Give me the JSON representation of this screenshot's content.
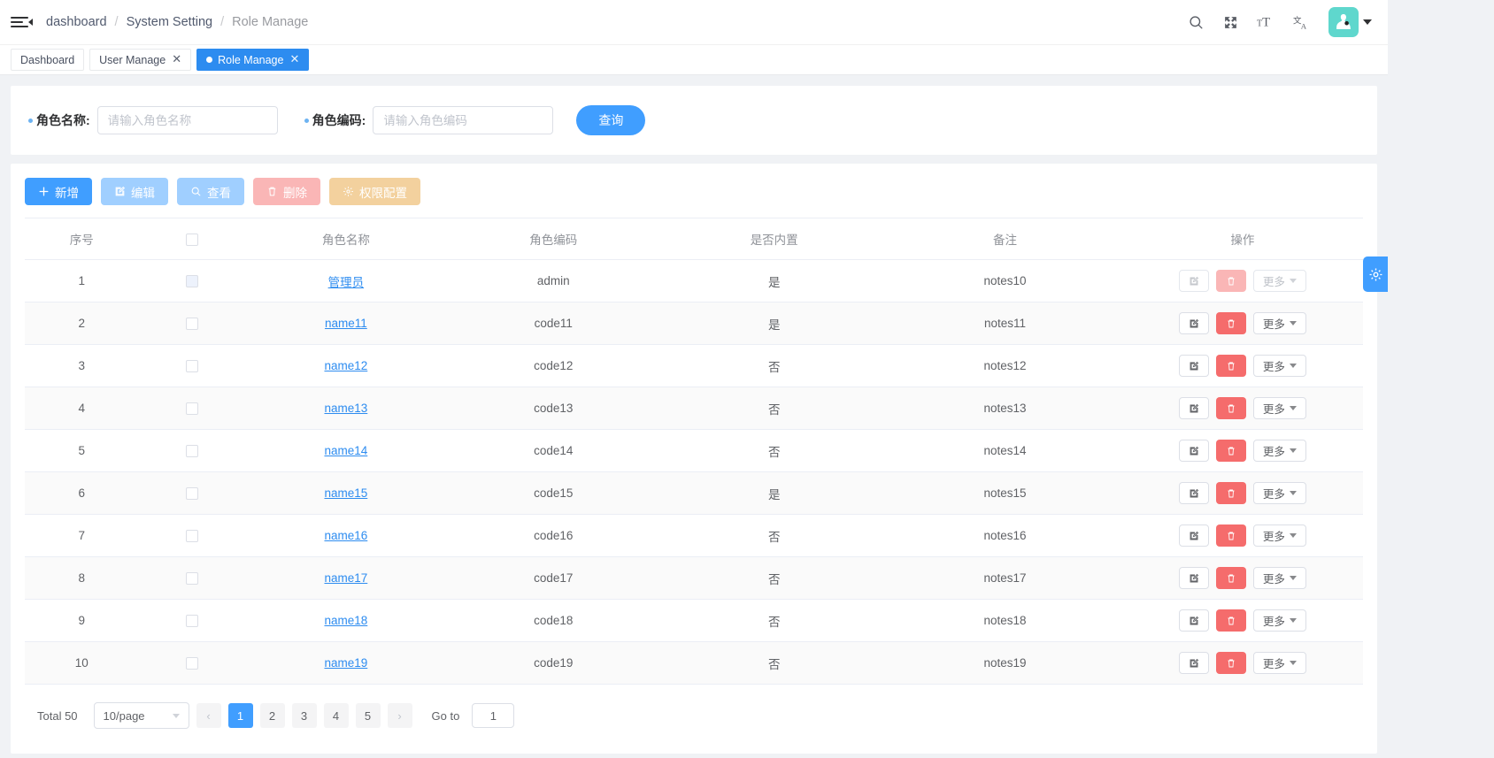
{
  "header": {
    "menu_icon": "hamburger-collapse-icon",
    "breadcrumb": [
      "dashboard",
      "System Setting",
      "Role Manage"
    ],
    "separator": "/",
    "icons": [
      "search-icon",
      "fullscreen-icon",
      "font-size-icon",
      "translate-icon"
    ],
    "avatar_icon": "user-avatar-icon",
    "accent": "#2d8cf0",
    "avatar_bg": "#5fd7cd"
  },
  "tabs": [
    {
      "label": "Dashboard",
      "closable": false,
      "active": false
    },
    {
      "label": "User Manage",
      "closable": true,
      "active": false
    },
    {
      "label": "Role Manage",
      "closable": true,
      "active": true
    }
  ],
  "search": {
    "fields": [
      {
        "label": "角色名称:",
        "placeholder": "请输入角色名称",
        "value": ""
      },
      {
        "label": "角色编码:",
        "placeholder": "请输入角色编码",
        "value": ""
      }
    ],
    "submit_label": "查询"
  },
  "toolbar": [
    {
      "label": "新增",
      "icon": "plus-icon",
      "style": "primary",
      "disabled": false
    },
    {
      "label": "编辑",
      "icon": "edit-icon",
      "style": "disabled-blue",
      "disabled": true
    },
    {
      "label": "查看",
      "icon": "search-icon",
      "style": "disabled-blue",
      "disabled": true
    },
    {
      "label": "删除",
      "icon": "trash-icon",
      "style": "disabled-red",
      "disabled": true
    },
    {
      "label": "权限配置",
      "icon": "gear-icon",
      "style": "warn",
      "disabled": false
    }
  ],
  "table": {
    "columns": [
      "序号",
      "",
      "角色名称",
      "角色编码",
      "是否内置",
      "备注",
      "操作"
    ],
    "rows": [
      {
        "index": "1",
        "name": "管理员",
        "code": "admin",
        "builtin": "是",
        "notes": "notes10",
        "locked": true
      },
      {
        "index": "2",
        "name": "name11",
        "code": "code11",
        "builtin": "是",
        "notes": "notes11",
        "locked": false
      },
      {
        "index": "3",
        "name": "name12",
        "code": "code12",
        "builtin": "否",
        "notes": "notes12",
        "locked": false
      },
      {
        "index": "4",
        "name": "name13",
        "code": "code13",
        "builtin": "否",
        "notes": "notes13",
        "locked": false
      },
      {
        "index": "5",
        "name": "name14",
        "code": "code14",
        "builtin": "否",
        "notes": "notes14",
        "locked": false
      },
      {
        "index": "6",
        "name": "name15",
        "code": "code15",
        "builtin": "是",
        "notes": "notes15",
        "locked": false
      },
      {
        "index": "7",
        "name": "name16",
        "code": "code16",
        "builtin": "否",
        "notes": "notes16",
        "locked": false
      },
      {
        "index": "8",
        "name": "name17",
        "code": "code17",
        "builtin": "否",
        "notes": "notes17",
        "locked": false
      },
      {
        "index": "9",
        "name": "name18",
        "code": "code18",
        "builtin": "否",
        "notes": "notes18",
        "locked": false
      },
      {
        "index": "10",
        "name": "name19",
        "code": "code19",
        "builtin": "否",
        "notes": "notes19",
        "locked": false
      }
    ],
    "row_ops": {
      "edit_icon": "edit-icon",
      "delete_icon": "trash-icon",
      "more_label": "更多"
    }
  },
  "pagination": {
    "total_label": "Total 50",
    "page_size_label": "10/page",
    "prev_icon": "chevron-left-icon",
    "next_icon": "chevron-right-icon",
    "pages": [
      "1",
      "2",
      "3",
      "4",
      "5"
    ],
    "current_page": "1",
    "goto_label": "Go to",
    "goto_value": "1"
  },
  "settings_tab": {
    "icon": "gear-icon"
  }
}
